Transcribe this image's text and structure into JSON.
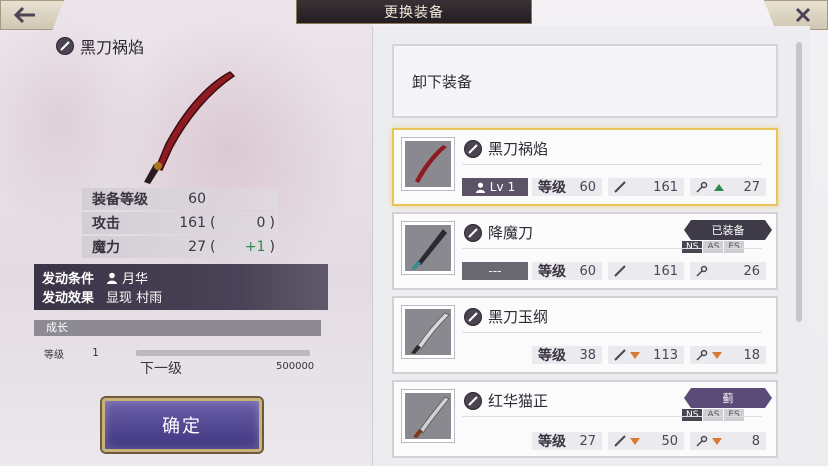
{
  "header": {
    "title": "更换装备",
    "back_icon": "arrow-left-icon",
    "close_icon": "close-icon"
  },
  "weapon": {
    "name": "黑刀祸焰",
    "stats": [
      {
        "label": "装备等级",
        "value": "60",
        "paren_open": "",
        "bonus": "",
        "paren_close": ""
      },
      {
        "label": "攻击",
        "value": "161",
        "paren_open": "(",
        "bonus": "0",
        "paren_close": ")"
      },
      {
        "label": "魔力",
        "value": "27",
        "paren_open": "(",
        "bonus": "+1",
        "paren_close": ")"
      }
    ],
    "skill": {
      "trigger_label": "发动条件",
      "trigger_value": "月华",
      "effect_label": "发动效果",
      "effect_value": "显现 村雨"
    }
  },
  "growth": {
    "title": "成长",
    "level_label": "等级",
    "level_value": "1",
    "progress": 0.0,
    "next_label": "下一级",
    "next_value": "500000"
  },
  "confirm_label": "确定",
  "unequip_label": "卸下装备",
  "items": [
    {
      "name": "黑刀祸焰",
      "lv_label": "Lv",
      "lv_value": "1",
      "grade_label": "等级",
      "grade": "60",
      "atk": "161",
      "mag": "27",
      "mag_trend": "up",
      "selected": true
    },
    {
      "name": "降魔刀",
      "lv_label": "---",
      "lv_value": "",
      "grade_label": "等级",
      "grade": "60",
      "atk": "161",
      "mag": "26",
      "badge": "已装备",
      "tags": [
        "NS",
        "AS",
        "ES"
      ]
    },
    {
      "name": "黑刀玉纲",
      "grade_label": "等级",
      "grade": "38",
      "atk": "113",
      "atk_trend": "down",
      "mag": "18",
      "mag_trend": "down"
    },
    {
      "name": "红华猫正",
      "grade_label": "等级",
      "grade": "27",
      "atk": "50",
      "atk_trend": "down",
      "mag": "8",
      "mag_trend": "down",
      "badge": "蓟",
      "tags": [
        "NS",
        "AS",
        "ES"
      ]
    }
  ],
  "colors": {
    "accent_gold": "#e8c45a",
    "up_green": "#2f8a4a",
    "down_orange": "#d87a33",
    "panel_purple": "#4a4256"
  }
}
